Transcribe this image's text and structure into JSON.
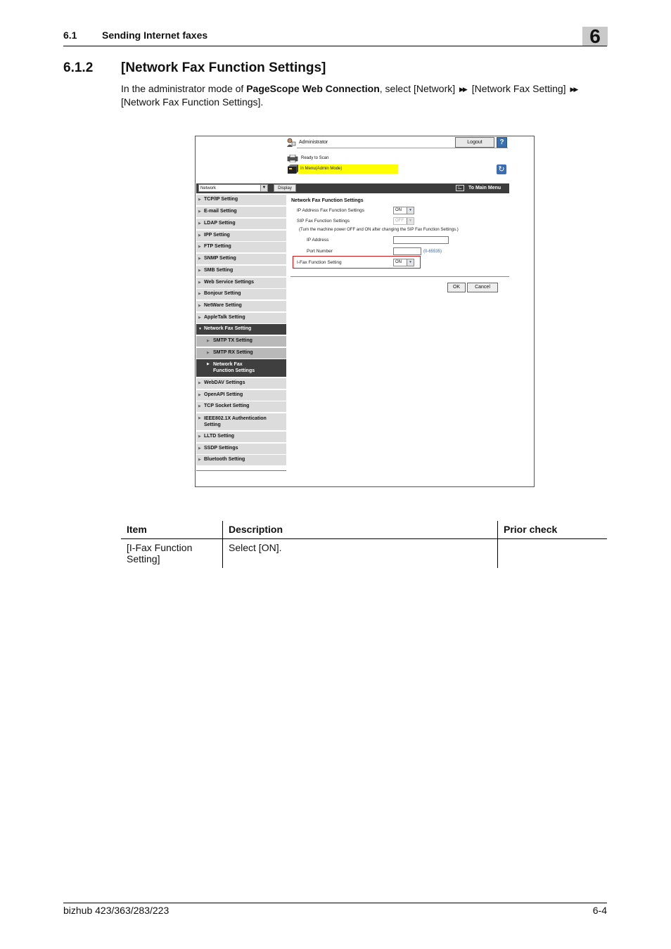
{
  "header": {
    "section_number": "6.1",
    "section_title": "Sending Internet faxes",
    "chapter_number": "6"
  },
  "heading": {
    "number": "6.1.2",
    "title": "[Network Fax Function Settings]"
  },
  "intro": {
    "part1": "In the administrator mode of ",
    "bold": "PageScope Web Connection",
    "part2": ", select [Network] ",
    "part3": " [Network Fax Setting] ",
    "part4": " [Network Fax Function Settings].",
    "arrow": "▶▶"
  },
  "screenshot": {
    "admin_label": "Administrator",
    "logout_label": "Logout",
    "help_icon": "?",
    "ready_label": "Ready to Scan",
    "inmenu_label": "In Menu(Admin Mode)",
    "refresh_icon": "↻",
    "network_select": "Network",
    "display_button": "Display",
    "main_menu_label": "To Main Menu",
    "sidebar": [
      {
        "label": "TCP/IP Setting"
      },
      {
        "label": "E-mail Setting"
      },
      {
        "label": "LDAP Setting"
      },
      {
        "label": "IPP Setting"
      },
      {
        "label": "FTP Setting"
      },
      {
        "label": "SNMP Setting"
      },
      {
        "label": "SMB Setting"
      },
      {
        "label": "Web Service Settings"
      },
      {
        "label": "Bonjour Setting"
      },
      {
        "label": "NetWare Setting"
      },
      {
        "label": "AppleTalk Setting"
      },
      {
        "label": "Network Fax Setting"
      },
      {
        "label": "SMTP TX Setting"
      },
      {
        "label": "SMTP RX Setting"
      },
      {
        "label": "Network Fax Function Settings"
      },
      {
        "label": "WebDAV Settings"
      },
      {
        "label": "OpenAPI Setting"
      },
      {
        "label": "TCP Socket Setting"
      },
      {
        "label": "IEEE802.1X Authentication Setting"
      },
      {
        "label": "LLTD Setting"
      },
      {
        "label": "SSDP Settings"
      },
      {
        "label": "Bluetooth Setting"
      }
    ],
    "form": {
      "title": "Network Fax Function Settings",
      "ip_fax_label": "IP Address Fax Function Settings",
      "ip_fax_value": "ON",
      "sip_fax_label": "SIP Fax Function Settings",
      "sip_fax_value": "OFF",
      "note": "(Turn the machine power OFF and ON after changing the SIP Fax Function Settings.)",
      "ip_address_label": "IP Address",
      "ip_address_value": "",
      "port_label": "Port Number",
      "port_value": "",
      "port_range": "(0-65535)",
      "ifax_label": "I-Fax Function Setting",
      "ifax_value": "ON",
      "ok_label": "OK",
      "cancel_label": "Cancel"
    }
  },
  "table": {
    "headers": [
      "Item",
      "Description",
      "Prior check"
    ],
    "rows": [
      {
        "item": "[I-Fax Function Setting]",
        "description": "Select [ON].",
        "prior_check": ""
      }
    ]
  },
  "footer": {
    "model": "bizhub 423/363/283/223",
    "page": "6-4"
  }
}
